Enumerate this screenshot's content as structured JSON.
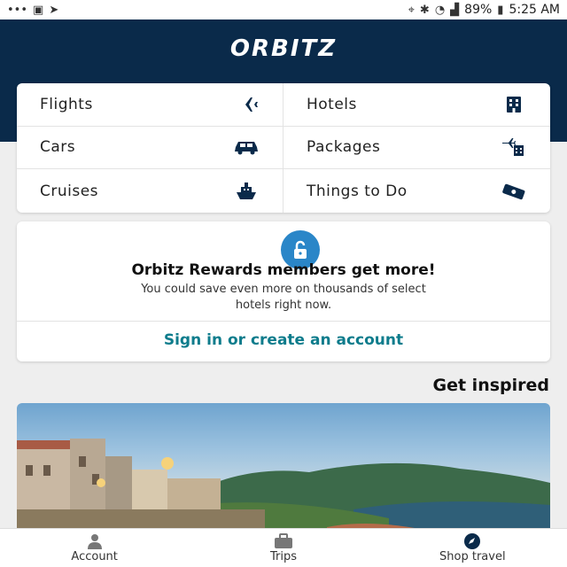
{
  "status_bar": {
    "time": "5:25 AM",
    "battery": "89%",
    "icons": [
      "more-dots-icon",
      "gallery-icon",
      "send-icon",
      "location-icon",
      "bluetooth-icon",
      "wifi-icon",
      "signal-icon",
      "battery-icon"
    ]
  },
  "header": {
    "logo": "ORBITZ",
    "bg_color": "#0a2a4a"
  },
  "products": [
    {
      "label": "Hotels",
      "icon": "hotel-icon"
    },
    {
      "label": "Flights",
      "icon": "airplane-icon"
    },
    {
      "label": "Packages",
      "icon": "package-icon"
    },
    {
      "label": "Cars",
      "icon": "car-icon"
    },
    {
      "label": "Things to Do",
      "icon": "ticket-icon"
    },
    {
      "label": "Cruises",
      "icon": "ship-icon"
    }
  ],
  "rewards": {
    "title": "Orbitz Rewards members get more!",
    "subtitle_line1": "You could save even more on thousands of select",
    "subtitle_line2": "hotels right now.",
    "link": "Sign in or create an account",
    "link_color": "#0e7c8c",
    "icon": "unlock-icon"
  },
  "inspired": {
    "title": "Get inspired"
  },
  "bottom_nav": [
    {
      "label": "Shop travel",
      "icon": "compass-icon"
    },
    {
      "label": "Trips",
      "icon": "suitcase-icon"
    },
    {
      "label": "Account",
      "icon": "person-icon"
    }
  ]
}
